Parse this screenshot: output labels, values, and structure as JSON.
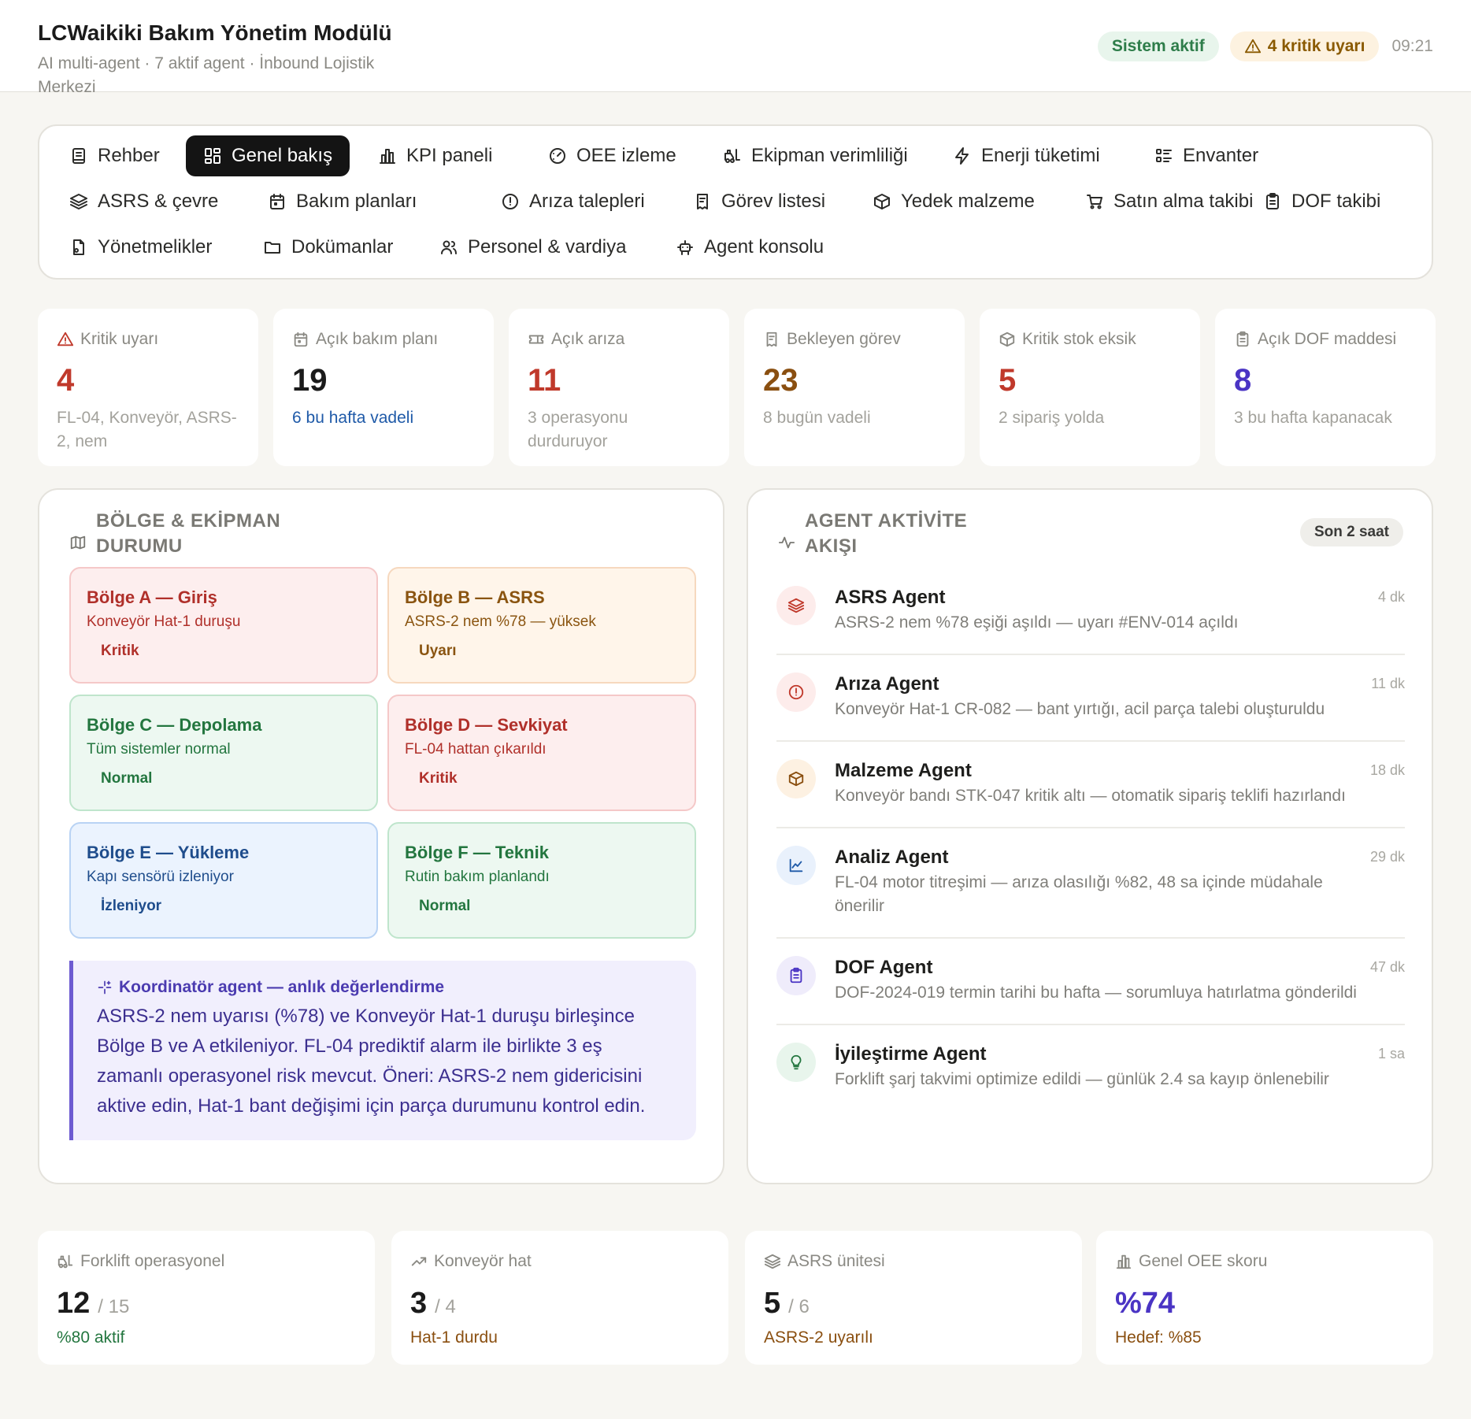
{
  "header": {
    "title": "LCWaikiki Bakım Yönetim Modülü",
    "subtitle": "AI multi-agent · 7 aktif agent · İnbound Lojistik Merkezi",
    "status": "Sistem aktif",
    "alerts": "4 kritik uyarı",
    "time": "09:21"
  },
  "nav": {
    "items": [
      {
        "label": "Rehber",
        "icon": "book-icon"
      },
      {
        "label": "Genel bakış",
        "icon": "dashboard-icon",
        "active": true
      },
      {
        "label": "KPI paneli",
        "icon": "bar-chart-icon"
      },
      {
        "label": "OEE izleme",
        "icon": "gauge-icon"
      },
      {
        "label": "Ekipman verimliliği",
        "icon": "forklift-icon"
      },
      {
        "label": "Enerji tüketimi",
        "icon": "lightning-icon"
      },
      {
        "label": "Envanter",
        "icon": "list-icon"
      },
      {
        "label": "ASRS & çevre",
        "icon": "layers-icon"
      },
      {
        "label": "Bakım planları",
        "icon": "calendar-icon"
      },
      {
        "label": "Arıza talepleri",
        "icon": "alert-circle-icon"
      },
      {
        "label": "Görev listesi",
        "icon": "receipt-icon"
      },
      {
        "label": "Yedek malzeme",
        "icon": "package-icon"
      },
      {
        "label": "Satın alma takibi",
        "icon": "cart-icon"
      },
      {
        "label": "DOF takibi",
        "icon": "clipboard-icon"
      },
      {
        "label": "Yönetmelikler",
        "icon": "document-icon"
      },
      {
        "label": "Dokümanlar",
        "icon": "folder-icon"
      },
      {
        "label": "Personel & vardiya",
        "icon": "users-icon"
      },
      {
        "label": "Agent konsolu",
        "icon": "bot-icon"
      }
    ]
  },
  "kpis": [
    {
      "label": "Kritik uyarı",
      "value": "4",
      "sub": "FL-04, Konveyör, ASRS-2, nem",
      "icon": "warning-icon",
      "color": "#c0392b",
      "subColor": "#a3a29c"
    },
    {
      "label": "Açık bakım planı",
      "value": "19",
      "sub": "6 bu hafta vadeli",
      "icon": "calendar-icon",
      "color": "#1b1b1b",
      "subColor": "#1f5aa8"
    },
    {
      "label": "Açık arıza",
      "value": "11",
      "sub": "3 operasyonu durduruyor",
      "icon": "ticket-icon",
      "color": "#c0392b",
      "subColor": "#a3a29c"
    },
    {
      "label": "Bekleyen görev",
      "value": "23",
      "sub": "8 bugün vadeli",
      "icon": "receipt-icon",
      "color": "#8a4f10",
      "subColor": "#a3a29c"
    },
    {
      "label": "Kritik stok eksik",
      "value": "5",
      "sub": "2 sipariş yolda",
      "icon": "package-icon",
      "color": "#c0392b",
      "subColor": "#a3a29c"
    },
    {
      "label": "Açık DOF maddesi",
      "value": "8",
      "sub": "3 bu hafta kapanacak",
      "icon": "clipboard-icon",
      "color": "#4a34c4",
      "subColor": "#a3a29c"
    }
  ],
  "zones": {
    "title": "BÖLGE & EKİPMAN DURUMU",
    "items": [
      {
        "name": "Bölge A — Giriş",
        "desc": "Konveyör Hat-1 duruşu",
        "status": "Kritik",
        "tone": "red"
      },
      {
        "name": "Bölge B — ASRS",
        "desc": "ASRS-2 nem %78 — yüksek",
        "status": "Uyarı",
        "tone": "orange"
      },
      {
        "name": "Bölge C — Depolama",
        "desc": "Tüm sistemler normal",
        "status": "Normal",
        "tone": "green"
      },
      {
        "name": "Bölge D — Sevkiyat",
        "desc": "FL-04 hattan çıkarıldı",
        "status": "Kritik",
        "tone": "red"
      },
      {
        "name": "Bölge E — Yükleme",
        "desc": "Kapı sensörü izleniyor",
        "status": "İzleniyor",
        "tone": "blue"
      },
      {
        "name": "Bölge F — Teknik",
        "desc": "Rutin bakım planlandı",
        "status": "Normal",
        "tone": "green"
      }
    ],
    "coordinator": {
      "title": "Koordinatör agent — anlık değerlendirme",
      "text": "ASRS-2 nem uyarısı (%78) ve Konveyör Hat-1 duruşu birleşince Bölge B ve A etkileniyor. FL-04 prediktif alarm ile birlikte 3 eş zamanlı operasyonel risk mevcut. Öneri: ASRS-2 nem gidericisini aktive edin, Hat-1 bant değişimi için parça durumunu kontrol edin."
    }
  },
  "feed": {
    "title": "AGENT AKTİVİTE AKIŞI",
    "badge": "Son 2 saat",
    "items": [
      {
        "name": "ASRS Agent",
        "desc": "ASRS-2 nem %78 eşiği aşıldı — uyarı #ENV-014 açıldı",
        "time": "4 dk",
        "icon": "layers-icon",
        "bg": "#fdeceb",
        "fg": "#c0392b"
      },
      {
        "name": "Arıza Agent",
        "desc": "Konveyör Hat-1 CR-082 — bant yırtığı, acil parça talebi oluşturuldu",
        "time": "11 dk",
        "icon": "alert-circle-icon",
        "bg": "#fdeceb",
        "fg": "#c0392b"
      },
      {
        "name": "Malzeme Agent",
        "desc": "Konveyör bandı STK-047 kritik altı — otomatik sipariş teklifi hazırlandı",
        "time": "18 dk",
        "icon": "package-icon",
        "bg": "#fdf1e2",
        "fg": "#8a4f10"
      },
      {
        "name": "Analiz Agent",
        "desc": "FL-04 motor titreşimi — arıza olasılığı %82, 48 sa içinde müdahale önerilir",
        "time": "29 dk",
        "icon": "chart-icon",
        "bg": "#e9f1fc",
        "fg": "#1f5aa8"
      },
      {
        "name": "DOF Agent",
        "desc": "DOF-2024-019 termin tarihi bu hafta — sorumluya hatırlatma gönderildi",
        "time": "47 dk",
        "icon": "clipboard-icon",
        "bg": "#efecfb",
        "fg": "#4a34c4"
      },
      {
        "name": "İyileştirme Agent",
        "desc": "Forklift şarj takvimi optimize edildi — günlük 2.4 sa kayıp önlenebilir",
        "time": "1 sa",
        "icon": "bulb-icon",
        "bg": "#e8f5ec",
        "fg": "#23763f"
      }
    ]
  },
  "stats": [
    {
      "label": "Forklift operasyonel",
      "value": "12",
      "total": "/ 15",
      "sub": "%80 aktif",
      "icon": "forklift-icon",
      "color": "#1b1b1b",
      "subColor": "#23763f"
    },
    {
      "label": "Konveyör hat",
      "value": "3",
      "total": "/ 4",
      "sub": "Hat-1 durdu",
      "icon": "trend-icon",
      "color": "#1b1b1b",
      "subColor": "#8a4f10"
    },
    {
      "label": "ASRS ünitesi",
      "value": "5",
      "total": "/ 6",
      "sub": "ASRS-2 uyarılı",
      "icon": "layers-icon",
      "color": "#1b1b1b",
      "subColor": "#8a4f10"
    },
    {
      "label": "Genel OEE skoru",
      "value": "%74",
      "total": "",
      "sub": "Hedef: %85",
      "icon": "bar-chart-icon",
      "color": "#4a34c4",
      "subColor": "#8a4f10"
    }
  ]
}
